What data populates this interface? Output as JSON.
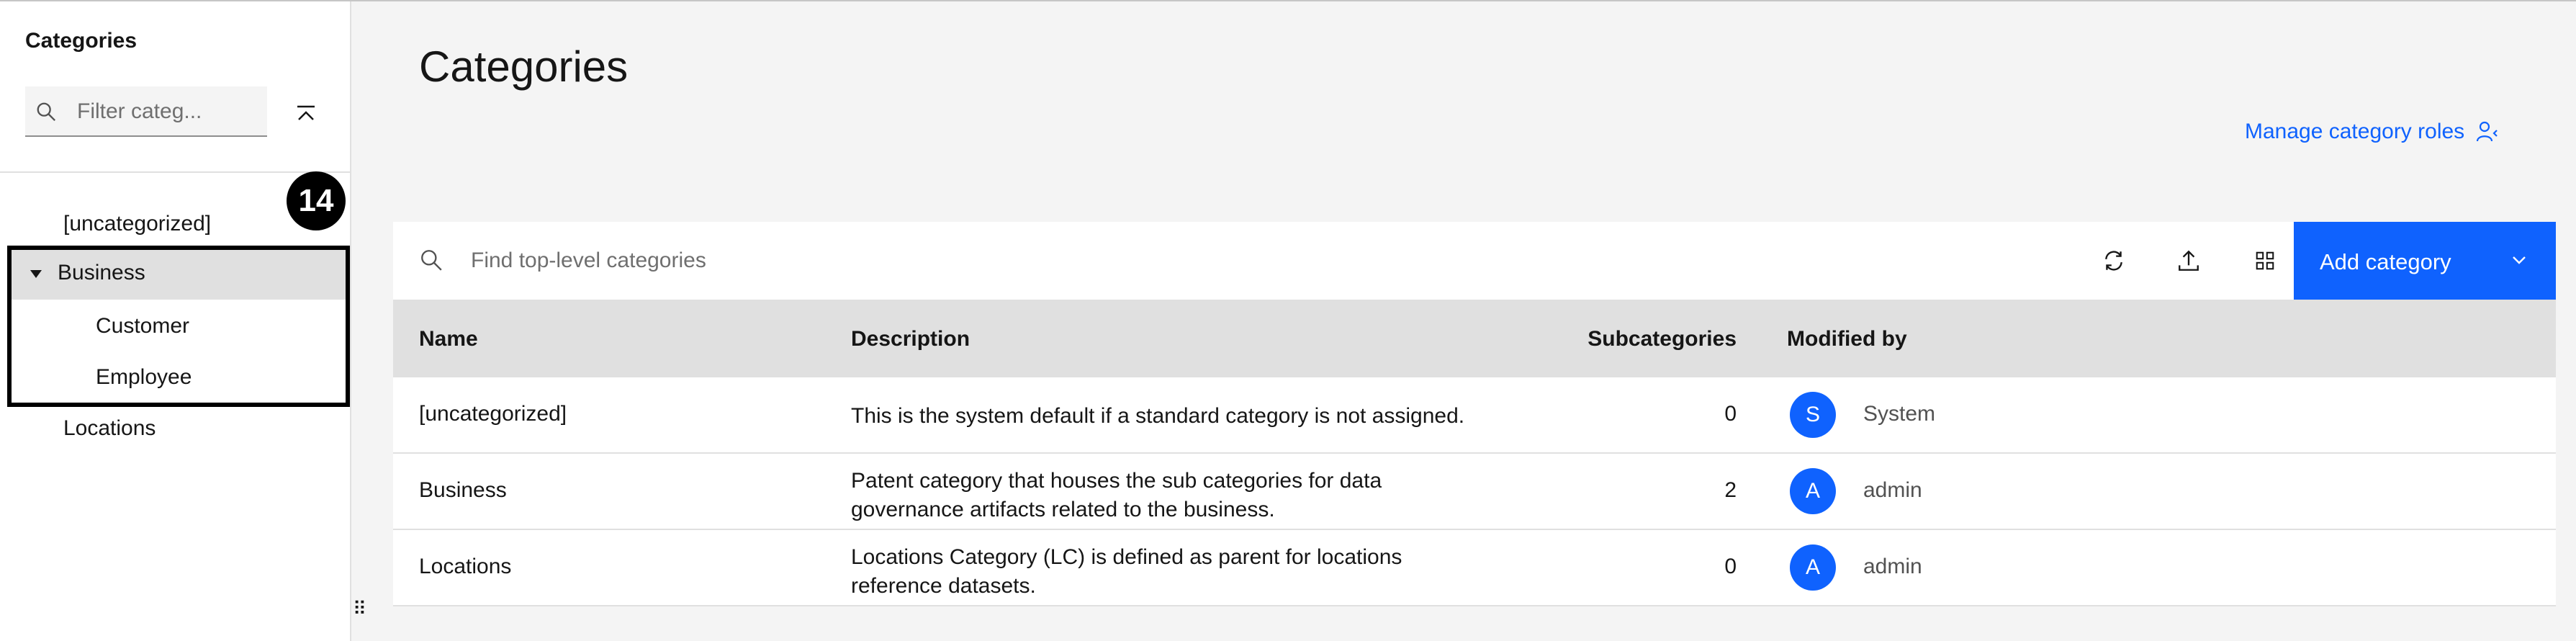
{
  "sidebar": {
    "title": "Categories",
    "filter_placeholder": "Filter categ...",
    "tree": {
      "uncategorized": "[uncategorized]",
      "business": "Business",
      "customer": "Customer",
      "employee": "Employee",
      "locations": "Locations"
    },
    "step_badge": "14"
  },
  "main": {
    "title": "Categories",
    "manage_roles_label": "Manage category roles",
    "search_placeholder": "Find top-level categories",
    "add_button_label": "Add category",
    "columns": {
      "name": "Name",
      "description": "Description",
      "subcategories": "Subcategories",
      "modified_by": "Modified by"
    },
    "rows": [
      {
        "name": "[uncategorized]",
        "description_line1": "This is the system default if a standard category is not assigned.",
        "description_line2": "",
        "subcategories": "0",
        "avatar": "S",
        "modified_by": "System"
      },
      {
        "name": "Business",
        "description_line1": "Patent category that houses the sub categories for data",
        "description_line2": "governance artifacts related to the business.",
        "subcategories": "2",
        "avatar": "A",
        "modified_by": "admin"
      },
      {
        "name": "Locations",
        "description_line1": "Locations Category (LC) is defined as parent for locations",
        "description_line2": "reference datasets.",
        "subcategories": "0",
        "avatar": "A",
        "modified_by": "admin"
      }
    ]
  },
  "colors": {
    "accent": "#0f62fe",
    "header_bg": "#e0e0e0",
    "page_bg": "#f4f4f4"
  },
  "icons": [
    "search-icon",
    "collapse-all-icon",
    "caret-down-icon",
    "refresh-icon",
    "upload-icon",
    "grid-view-icon",
    "chevron-down-icon",
    "user-role-icon",
    "drag-handle-icon"
  ]
}
